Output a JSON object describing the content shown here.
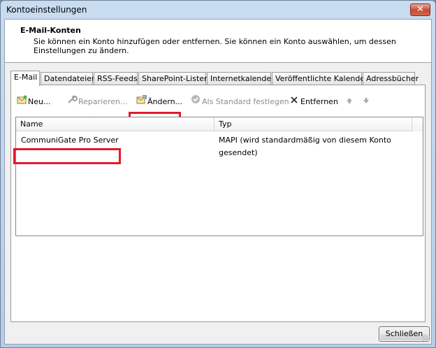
{
  "window": {
    "title": "Kontoeinstellungen",
    "close_glyph": "✕"
  },
  "header": {
    "title": "E-Mail-Konten",
    "description": "Sie können ein Konto hinzufügen oder entfernen. Sie können ein Konto auswählen, um dessen Einstellungen zu ändern."
  },
  "tabs": [
    {
      "label": "E-Mail",
      "active": true
    },
    {
      "label": "Datendateien"
    },
    {
      "label": "RSS-Feeds"
    },
    {
      "label": "SharePoint-Listen"
    },
    {
      "label": "Internetkalender"
    },
    {
      "label": "Veröffentlichte Kalender"
    },
    {
      "label": "Adressbücher"
    }
  ],
  "toolbar": {
    "new_label": "Neu...",
    "repair_label": "Reparieren...",
    "change_label": "Ändern...",
    "set_default_label": "Als Standard festlegen",
    "remove_label": "Entfernen",
    "new_icon": "new-account-icon",
    "repair_icon": "wrench-icon",
    "change_icon": "change-account-icon",
    "default_icon": "checkmark-icon",
    "remove_icon": "x-icon",
    "up_icon": "arrow-up-icon",
    "down_icon": "arrow-down-icon"
  },
  "list": {
    "columns": [
      "Name",
      "Typ"
    ],
    "rows": [
      {
        "name": "CommuniGate Pro Server",
        "type": "MAPI (wird standardmäßig von diesem Konto gesendet)"
      }
    ]
  },
  "footer": {
    "close_label": "Schließen"
  },
  "colors": {
    "highlight": "#e01b2b"
  }
}
